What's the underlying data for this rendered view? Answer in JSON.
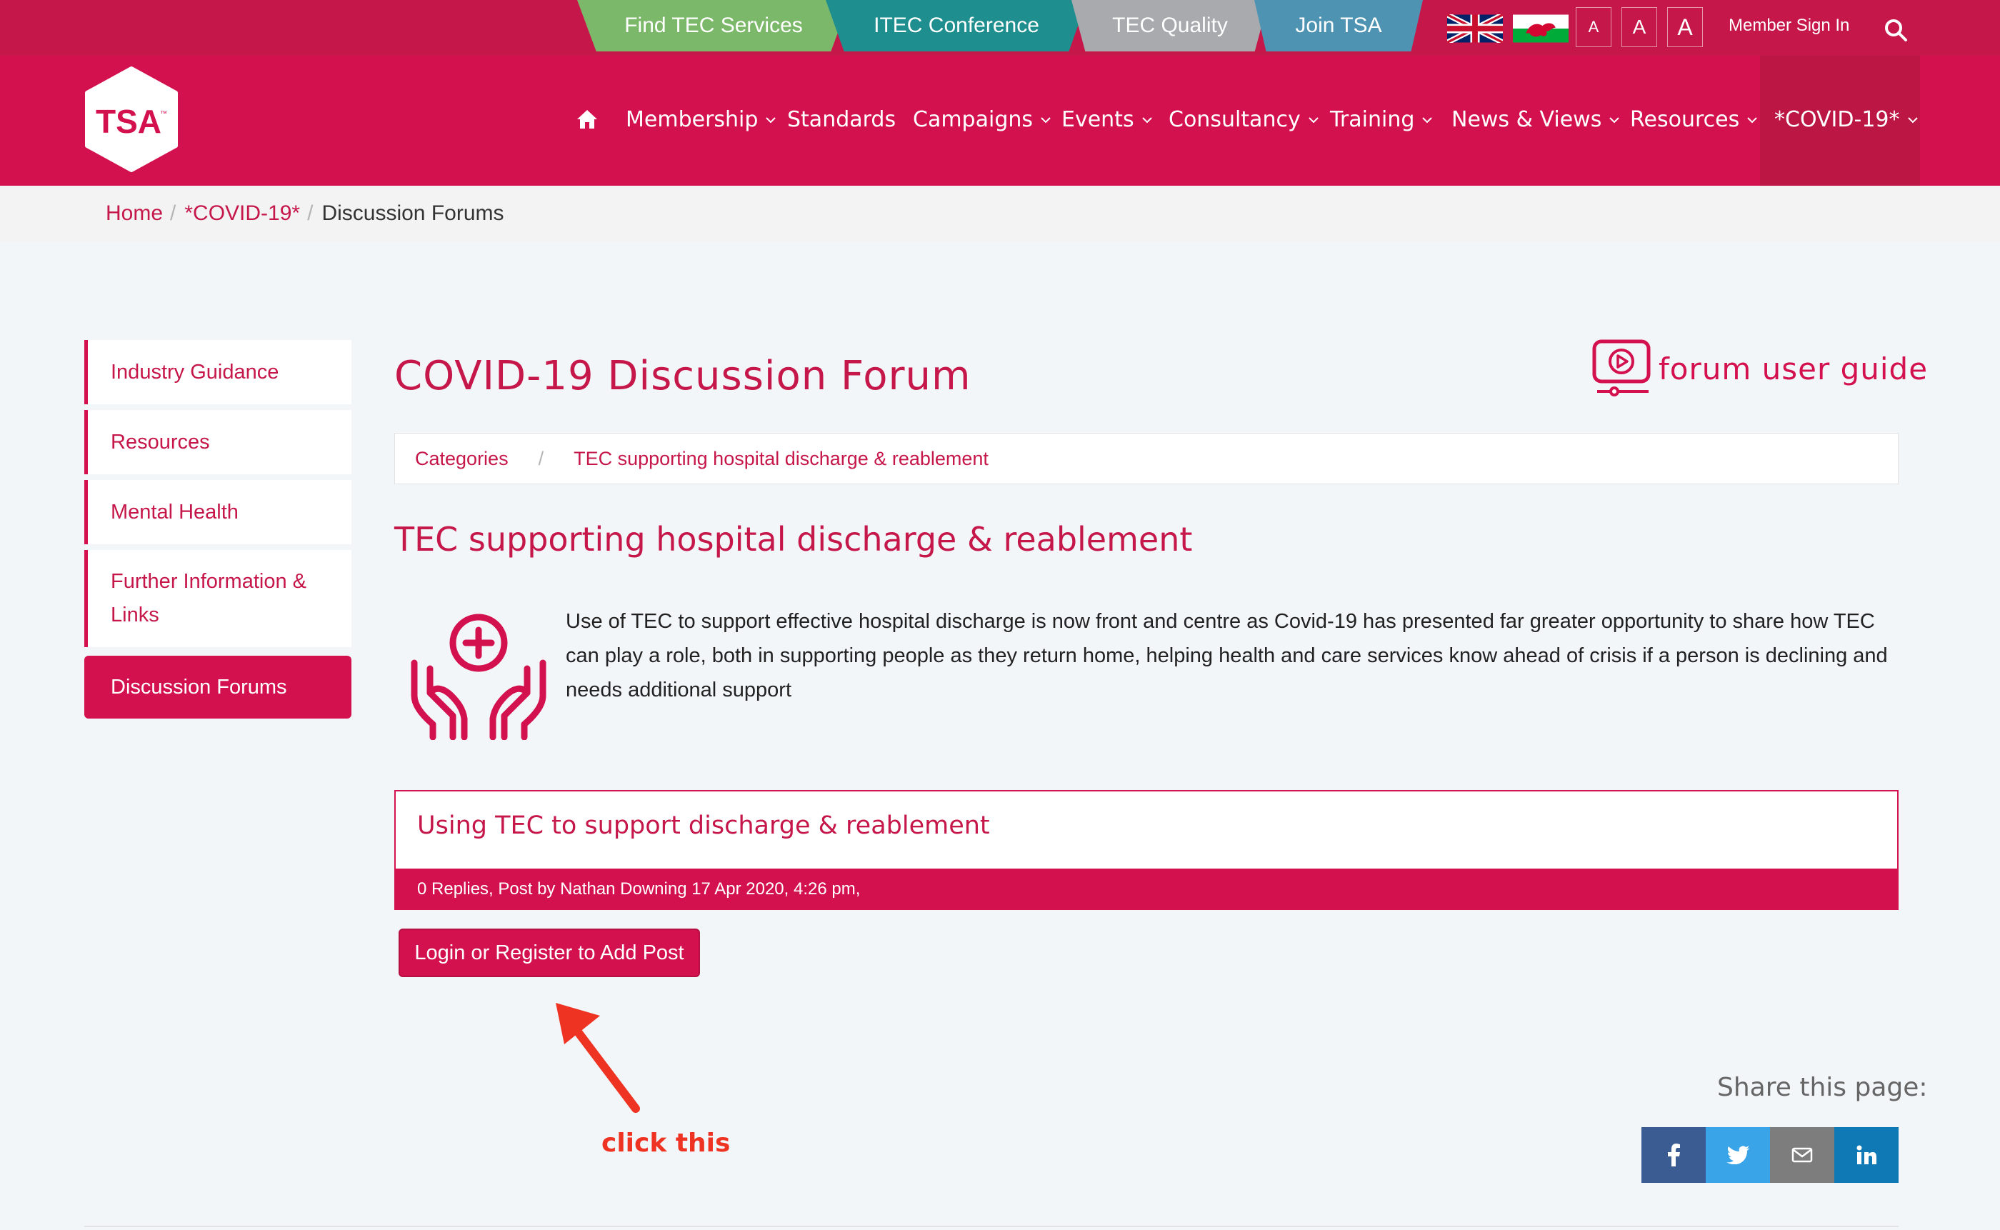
{
  "topbar": {
    "tabs": [
      {
        "label": "Find TEC Services",
        "color": "#7cb86a"
      },
      {
        "label": "ITEC Conference",
        "color": "#1f8e8e"
      },
      {
        "label": "TEC Quality",
        "color": "#a8aaae"
      },
      {
        "label": "Join TSA",
        "color": "#4f93b3"
      }
    ],
    "languages": [
      "uk-flag-icon",
      "wales-flag-icon"
    ],
    "font_sizes": [
      "A",
      "A",
      "A"
    ],
    "sign_in": "Member Sign In",
    "search_icon": "search-icon"
  },
  "logo": {
    "text": "TSA",
    "mark": "™"
  },
  "nav": {
    "home_icon": "home-icon",
    "items": [
      {
        "label": "Membership",
        "has_dropdown": true
      },
      {
        "label": "Standards",
        "has_dropdown": false
      },
      {
        "label": "Campaigns",
        "has_dropdown": true
      },
      {
        "label": "Events",
        "has_dropdown": true
      },
      {
        "label": "Consultancy",
        "has_dropdown": true
      },
      {
        "label": "Training",
        "has_dropdown": true
      },
      {
        "label": "News & Views",
        "has_dropdown": true
      },
      {
        "label": "Resources",
        "has_dropdown": true
      },
      {
        "label": "*COVID-19*",
        "has_dropdown": true
      }
    ]
  },
  "breadcrumb": {
    "items": [
      "Home",
      "*COVID-19*"
    ],
    "current": "Discussion Forums"
  },
  "sidebar": {
    "items": [
      {
        "label": "Industry Guidance"
      },
      {
        "label": "Resources"
      },
      {
        "label": "Mental Health"
      },
      {
        "label": "Further Information & Links"
      },
      {
        "label": "Discussion Forums",
        "active": true
      }
    ]
  },
  "main": {
    "title": "COVID-19 Discussion Forum",
    "guide_label": "forum user guide",
    "categories": {
      "root": "Categories",
      "current": "TEC supporting hospital discharge & reablement"
    },
    "section_title": "TEC supporting hospital discharge & reablement",
    "description": "Use of TEC to support effective hospital discharge is now front and centre as Covid-19 has presented far greater opportunity to share how TEC can play a role, both in supporting people as they return home, helping health and care services know ahead of crisis if a person is declining and needs additional support",
    "thread": {
      "title": "Using TEC to support discharge & reablement",
      "meta": "0 Replies, Post by Nathan Downing 17 Apr 2020, 4:26 pm,"
    },
    "add_post_label": "Login or Register to Add Post",
    "annotation": "click this",
    "share_label": "Share this page:"
  },
  "colors": {
    "brand": "#d4114f",
    "topbar": "#c6174a",
    "annotation": "#ee3323"
  }
}
